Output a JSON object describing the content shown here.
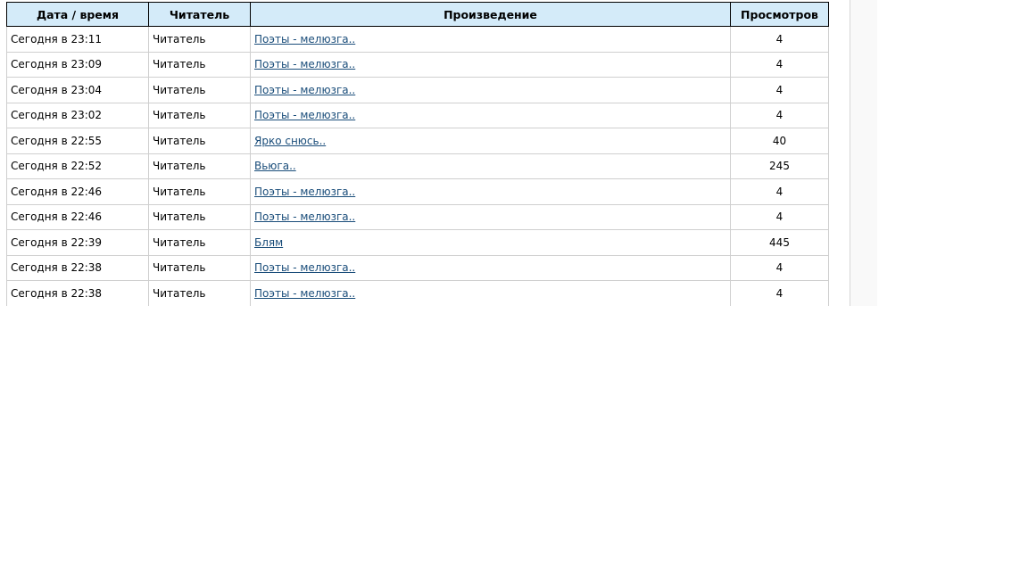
{
  "table": {
    "headers": {
      "datetime": "Дата / время",
      "reader": "Читатель",
      "work": "Произведение",
      "views": "Просмотров"
    },
    "rows": [
      {
        "datetime": "Сегодня в 23:11",
        "reader": "Читатель",
        "work": "Поэты - мелюзга..",
        "views": "4"
      },
      {
        "datetime": "Сегодня в 23:09",
        "reader": "Читатель",
        "work": "Поэты - мелюзга..",
        "views": "4"
      },
      {
        "datetime": "Сегодня в 23:04",
        "reader": "Читатель",
        "work": "Поэты - мелюзга..",
        "views": "4"
      },
      {
        "datetime": "Сегодня в 23:02",
        "reader": "Читатель",
        "work": "Поэты - мелюзга..",
        "views": "4"
      },
      {
        "datetime": "Сегодня в 22:55",
        "reader": "Читатель",
        "work": "Ярко снюсь..",
        "views": "40"
      },
      {
        "datetime": "Сегодня в 22:52",
        "reader": "Читатель",
        "work": "Вьюга..",
        "views": "245"
      },
      {
        "datetime": "Сегодня в 22:46",
        "reader": "Читатель",
        "work": "Поэты - мелюзга..",
        "views": "4"
      },
      {
        "datetime": "Сегодня в 22:46",
        "reader": "Читатель",
        "work": "Поэты - мелюзга..",
        "views": "4"
      },
      {
        "datetime": "Сегодня в 22:39",
        "reader": "Читатель",
        "work": "Блям",
        "views": "445"
      },
      {
        "datetime": "Сегодня в 22:38",
        "reader": "Читатель",
        "work": "Поэты - мелюзга..",
        "views": "4"
      },
      {
        "datetime": "Сегодня в 22:38",
        "reader": "Читатель",
        "work": "Поэты - мелюзга..",
        "views": "4"
      }
    ]
  },
  "colors": {
    "header_bg": "#d4ebf9",
    "link": "#1a4d7a",
    "grid": "#cfcfcf"
  }
}
